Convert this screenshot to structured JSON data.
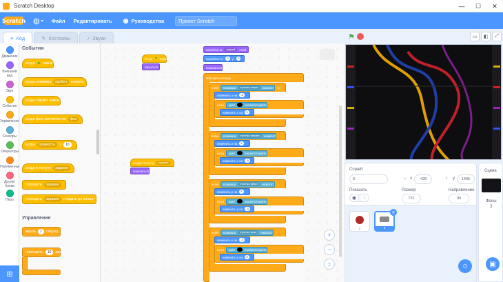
{
  "window": {
    "title": "Scratch Desktop",
    "minimize": "—",
    "maximize": "☐",
    "close": "✕"
  },
  "menubar": {
    "logo": "Scratch",
    "globe_icon": "globe-icon",
    "file": "Файл",
    "edit": "Редактировать",
    "tutorials": "Руководства",
    "project_name": "Проект Scratch"
  },
  "tabs": [
    {
      "label": "Код",
      "icon": "code-icon"
    },
    {
      "label": "Костюмы",
      "icon": "brush-icon"
    },
    {
      "label": "Звуки",
      "icon": "speaker-icon"
    }
  ],
  "categories": [
    {
      "label": "Движение",
      "color": "#4c97ff"
    },
    {
      "label": "Внешний вид",
      "color": "#9966ff"
    },
    {
      "label": "Звук",
      "color": "#cf63cf"
    },
    {
      "label": "События",
      "color": "#ffbf00"
    },
    {
      "label": "Управление",
      "color": "#ffab19"
    },
    {
      "label": "Сенсоры",
      "color": "#5cb1d6"
    },
    {
      "label": "Операторы",
      "color": "#59c059"
    },
    {
      "label": "Переменные",
      "color": "#ff8c1a"
    },
    {
      "label": "Другие блоки",
      "color": "#ff6680"
    },
    {
      "label": "Перо",
      "color": "#0fbd8c"
    }
  ],
  "palette": {
    "events_title": "События",
    "control_title": "Управление",
    "blocks": {
      "flag_clicked": "когда",
      "flag_clicked_2": "нажат",
      "key_pressed": "когда клавиша",
      "key_value": "пробел",
      "key_pressed_2": "нажата",
      "sprite_clicked": "когда спрайт нажат",
      "backdrop_switch": "когда фон сменится на",
      "backdrop_value": "фон",
      "loudness": "когда",
      "loudness_value": "громкость",
      "loudness_num": "10",
      "receive": "когда я получу",
      "receive_value": "задание",
      "broadcast": "передать",
      "broadcast_value": "задание",
      "broadcast_wait": "передать",
      "broadcast_wait_value": "задание",
      "broadcast_wait_2": "и ждать до конца",
      "wait": "ждать",
      "wait_value": "1",
      "wait_2": "секунд",
      "repeat": "повторить",
      "repeat_value": "10",
      "repeat_2": "раз"
    }
  },
  "script": {
    "s1_hat": "когда",
    "s1_hat_2": "нажат",
    "s1_hide": "скрыться",
    "s2_hat": "когда я получу",
    "s2_hat_value": "задание",
    "s2_show": "показаться",
    "goto_layer": "перейти на",
    "goto_layer_value": "задний",
    "goto_layer_2": "слой",
    "goto_xy": "перейти в x:",
    "goto_xy_x": "0",
    "goto_xy_y_label": "y:",
    "goto_xy_y": "0",
    "show": "показаться",
    "forever": "повторять всегда",
    "if": "если",
    "then": "то",
    "key_down": "клавиша",
    "arrow_left": "стрелка влево",
    "arrow_right": "стрелка вправо",
    "arrow_up": "стрелка вверх",
    "arrow_down": "стрелка вниз",
    "pressed": "нажата?",
    "change_x": "изменить x на",
    "change_x_value": "-5",
    "change_x_value_2": "5",
    "change_y": "изменить y на",
    "change_y_value": "5",
    "change_y_value_2": "-5",
    "touching_color": "цвет",
    "touching_color_2": "касается цвета",
    "or": "или"
  },
  "stage": {
    "green_flag_icon": "green-flag-icon",
    "stop_icon": "stop-icon",
    "small_stage_icon": "small-stage-icon",
    "large_stage_icon": "large-stage-icon",
    "fullscreen_icon": "fullscreen-icon",
    "background_color": "#0e0e10"
  },
  "sprite_info": {
    "sprite_label": "Спрайт",
    "sprite_name": "3",
    "x_label": "x",
    "x_value": "-430",
    "y_label": "y",
    "y_value": "1495",
    "show_label": "Показать",
    "size_label": "Размер",
    "size_value": "721",
    "direction_label": "Направление",
    "direction_value": "90"
  },
  "sprites": [
    {
      "name": "1",
      "selected": false
    },
    {
      "name": "3",
      "selected": true
    }
  ],
  "stage_pane": {
    "title": "Сцена",
    "backdrops_label": "Фоны",
    "backdrops_count": "3"
  }
}
